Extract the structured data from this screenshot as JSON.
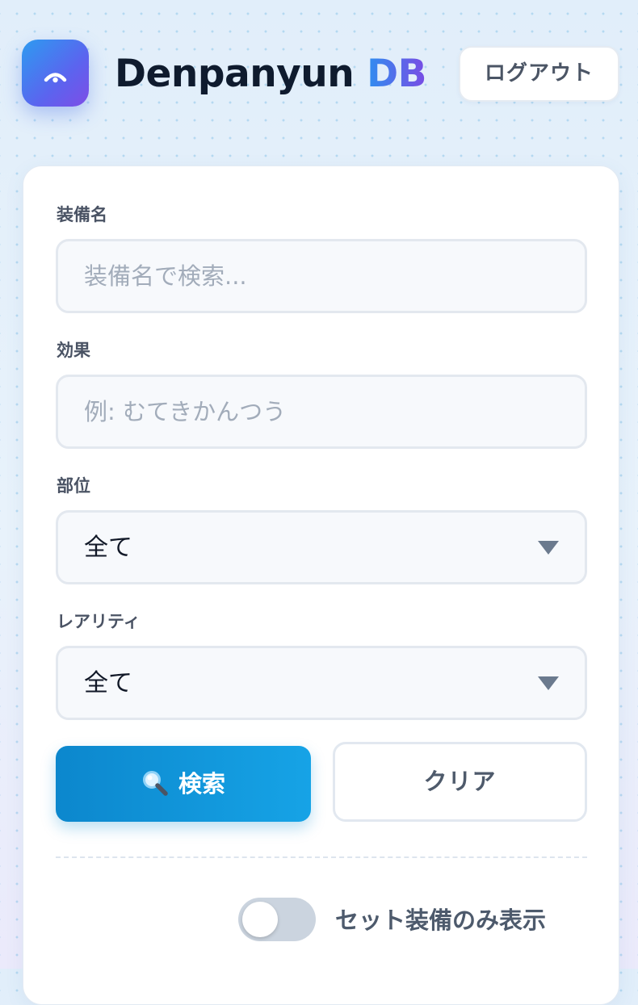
{
  "header": {
    "logo_icon": "radar-arc-icon",
    "title_main": "Denpanyun",
    "title_accent": "DB",
    "logout_label": "ログアウト"
  },
  "search_form": {
    "equipment_name": {
      "label": "装備名",
      "value": "",
      "placeholder": "装備名で検索..."
    },
    "effect": {
      "label": "効果",
      "value": "",
      "placeholder": "例: むてきかんつう"
    },
    "slot": {
      "label": "部位",
      "selected": "全て"
    },
    "rarity": {
      "label": "レアリティ",
      "selected": "全て"
    },
    "search_button": {
      "icon": "magnifier-icon",
      "label": "検索"
    },
    "clear_button": {
      "label": "クリア"
    },
    "set_only_toggle": {
      "label": "セット装備のみ表示",
      "checked": false
    }
  },
  "colors": {
    "accent_gradient_start": "#2f8ff0",
    "accent_gradient_end": "#7a4be4",
    "primary_button": "#0c87cd",
    "toggle_off": "#cbd4df",
    "text_dark": "#0f1b2e"
  }
}
